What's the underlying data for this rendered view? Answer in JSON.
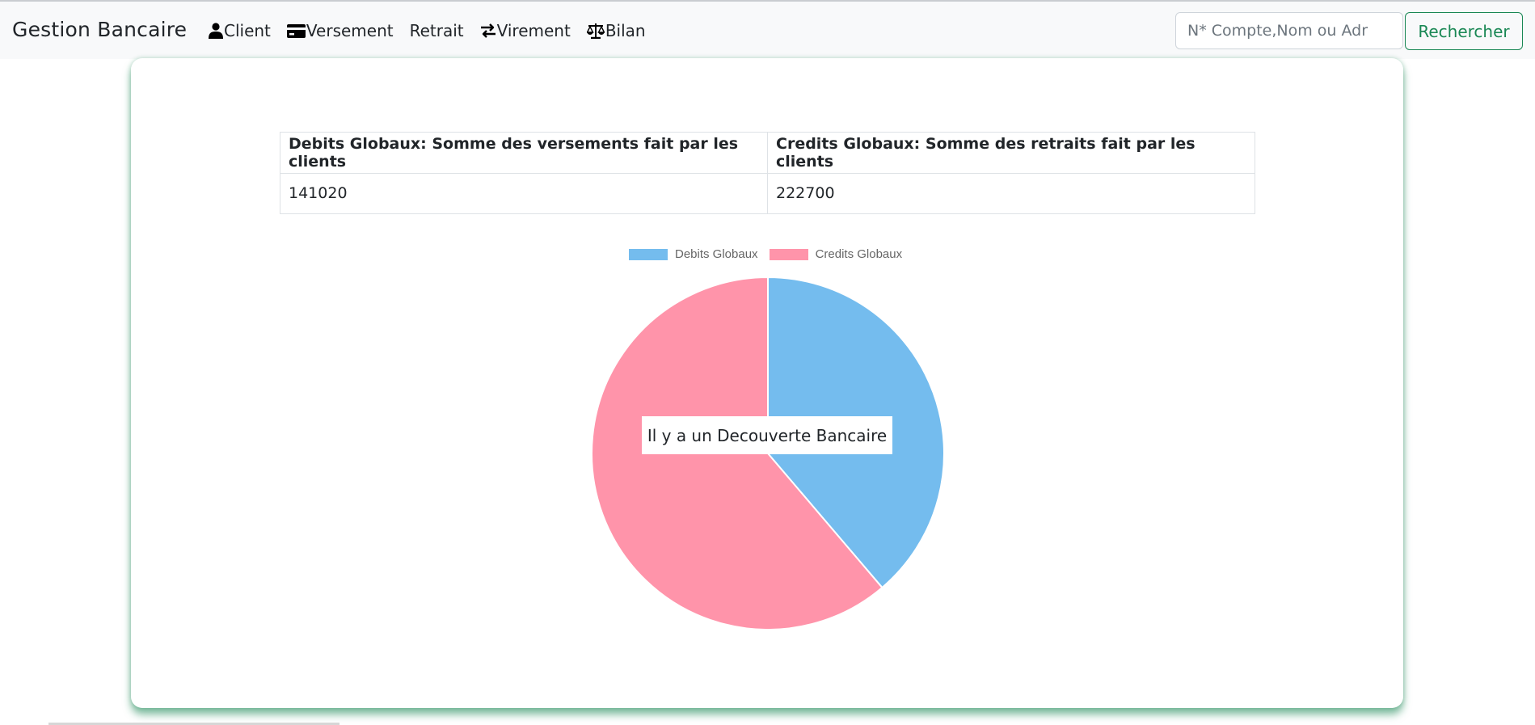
{
  "navbar": {
    "brand": "Gestion Bancaire",
    "links": [
      {
        "label": "Client",
        "icon": "user-icon"
      },
      {
        "label": "Versement",
        "icon": "credit-card-icon"
      },
      {
        "label": "Retrait",
        "icon": ""
      },
      {
        "label": "Virement",
        "icon": "transfer-arrows-icon"
      },
      {
        "label": "Bilan",
        "icon": "balance-scale-icon"
      }
    ],
    "search": {
      "placeholder": "N* Compte,Nom ou Adr",
      "value": "",
      "button_label": "Rechercher"
    }
  },
  "summary_table": {
    "headers": [
      "Debits Globaux: Somme des versements fait par les clients",
      "Credits Globaux: Somme des retraits fait par les clients"
    ],
    "values": [
      "141020",
      "222700"
    ]
  },
  "overlay_text": "Il y a un Decouverte Bancaire",
  "colors": {
    "debits": "#74bcee",
    "credits": "#ff94aa",
    "accent": "#198754"
  },
  "chart_data": {
    "type": "pie",
    "categories": [
      "Debits Globaux",
      "Credits Globaux"
    ],
    "values": [
      141020,
      222700
    ],
    "legend_position": "top"
  }
}
